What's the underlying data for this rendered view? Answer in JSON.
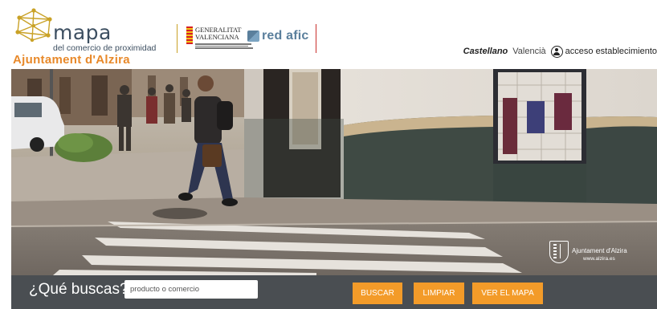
{
  "header": {
    "logo": {
      "word": "mapa",
      "tagline": "del comercio de proximidad"
    },
    "site_title": "Ajuntament d'Alzira",
    "partners": {
      "generalitat": {
        "line1": "GENERALITAT",
        "line2": "VALENCIANA"
      },
      "redafic": "red afic"
    },
    "languages": {
      "active": "Castellano",
      "other": "Valencià"
    },
    "access_label": "acceso establecimiento"
  },
  "hero": {
    "watermark": {
      "name": "Ajuntament d'Alzira",
      "url": "www.alzira.es"
    }
  },
  "search": {
    "label": "¿Qué buscas?",
    "placeholder": "producto o comercio",
    "value": "",
    "buttons": {
      "search": "BUSCAR",
      "clear": "LIMPIAR",
      "map": "VER EL MAPA"
    }
  },
  "colors": {
    "accent": "#f39b29",
    "title": "#e8892a",
    "logo_text": "#3d4f61",
    "search_bar": "#4a4e52"
  }
}
